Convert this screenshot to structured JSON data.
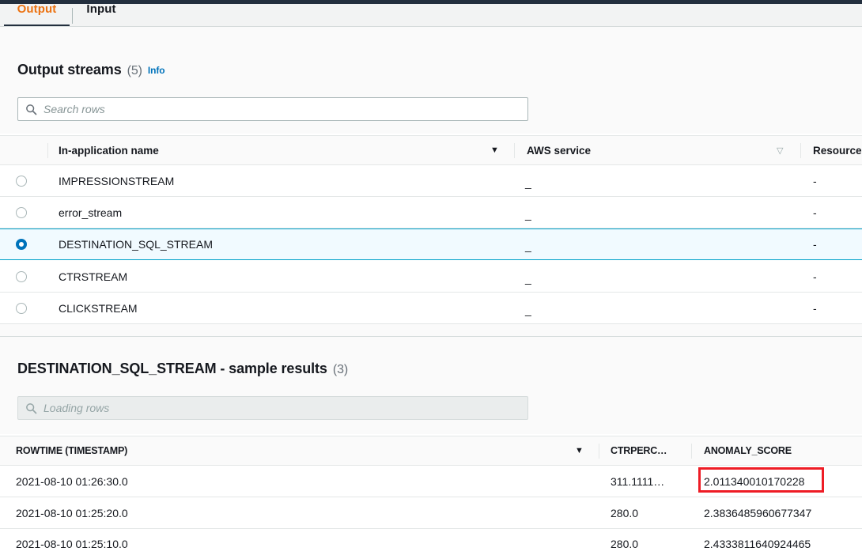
{
  "tabs": [
    {
      "label": "Output",
      "active": true
    },
    {
      "label": "Input",
      "active": false
    }
  ],
  "output_streams": {
    "title": "Output streams",
    "count": "(5)",
    "info_label": "Info",
    "search": {
      "placeholder": "Search rows",
      "value": "",
      "icon": "search-icon"
    },
    "columns": [
      {
        "label": "In-application name",
        "sort_icon": "sort-caret-filled"
      },
      {
        "label": "AWS service",
        "sort_icon": "sort-caret-hollow"
      },
      {
        "label": "Resource",
        "sort_icon": ""
      }
    ],
    "rows": [
      {
        "name": "IMPRESSIONSTREAM",
        "aws_service": "_",
        "resource": "-",
        "selected": false
      },
      {
        "name": "error_stream",
        "aws_service": "_",
        "resource": "-",
        "selected": false
      },
      {
        "name": "DESTINATION_SQL_STREAM",
        "aws_service": "_",
        "resource": "-",
        "selected": true
      },
      {
        "name": "CTRSTREAM",
        "aws_service": "_",
        "resource": "-",
        "selected": false
      },
      {
        "name": "CLICKSTREAM",
        "aws_service": "_",
        "resource": "-",
        "selected": false
      }
    ]
  },
  "sample_results": {
    "title": "DESTINATION_SQL_STREAM - sample results",
    "count": "(3)",
    "search": {
      "placeholder": "Loading rows",
      "value": "",
      "icon": "search-icon",
      "disabled": true
    },
    "columns": [
      {
        "label": "ROWTIME (TIMESTAMP)",
        "sort_icon": "sort-caret-filled"
      },
      {
        "label": "CTRPERC…",
        "sort_icon": ""
      },
      {
        "label": "ANOMALY_SCORE",
        "sort_icon": ""
      }
    ],
    "rows": [
      {
        "rowtime": "2021-08-10 01:26:30.0",
        "ctrperc": "311.1111…",
        "anomaly_score": "2.011340010170228",
        "highlighted": true
      },
      {
        "rowtime": "2021-08-10 01:25:20.0",
        "ctrperc": "280.0",
        "anomaly_score": "2.3836485960677347",
        "highlighted": false
      },
      {
        "rowtime": "2021-08-10 01:25:10.0",
        "ctrperc": "280.0",
        "anomaly_score": "2.4333811640924465",
        "highlighted": false
      }
    ]
  },
  "colors": {
    "accent_orange": "#ec7211",
    "link_blue": "#0073bb",
    "selected_border": "#00a1c9",
    "selected_bg": "#f1faff",
    "annotation_red": "#ee1c25",
    "header_navy": "#232f3e"
  }
}
